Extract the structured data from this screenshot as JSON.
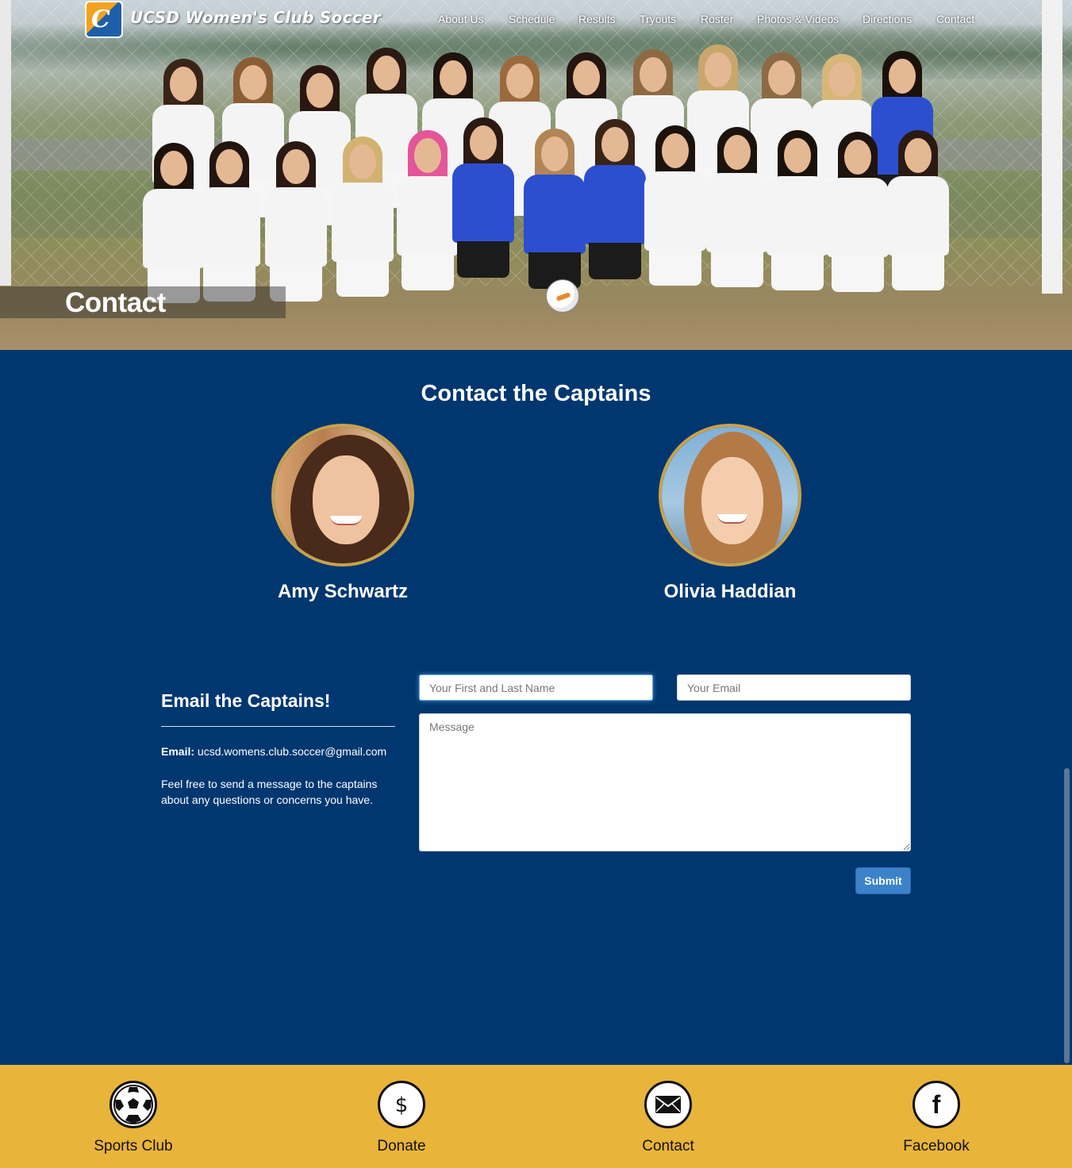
{
  "brand": {
    "logo_letter": "C",
    "name": "UCSD Women's Club Soccer"
  },
  "nav": {
    "items": [
      "About Us",
      "Schedule",
      "Results",
      "Tryouts",
      "Roster",
      "Photos & Videos",
      "Directions",
      "Contact"
    ]
  },
  "hero": {
    "title": "Contact"
  },
  "captains": {
    "heading": "Contact the Captains",
    "people": [
      {
        "name": "Amy Schwartz"
      },
      {
        "name": "Olivia Haddian"
      }
    ]
  },
  "email": {
    "heading": "Email the Captains!",
    "email_label": "Email:",
    "email_value": "ucsd.womens.club.soccer@gmail.com",
    "note": "Feel free to send a message to the captains about any questions or concerns you have."
  },
  "form": {
    "name_placeholder": "Your First and Last Name",
    "email_placeholder": "Your Email",
    "message_placeholder": "Message",
    "submit_label": "Submit"
  },
  "footer": {
    "items": [
      {
        "label": "Sports Club",
        "icon": "soccer-ball-icon"
      },
      {
        "label": "Donate",
        "icon": "dollar-icon"
      },
      {
        "label": "Contact",
        "icon": "envelope-icon"
      },
      {
        "label": "Facebook",
        "icon": "facebook-icon"
      }
    ]
  },
  "colors": {
    "navy": "#003770",
    "gold": "#e8b43a",
    "frame": "#c8a24c",
    "button": "#3b82c9"
  }
}
